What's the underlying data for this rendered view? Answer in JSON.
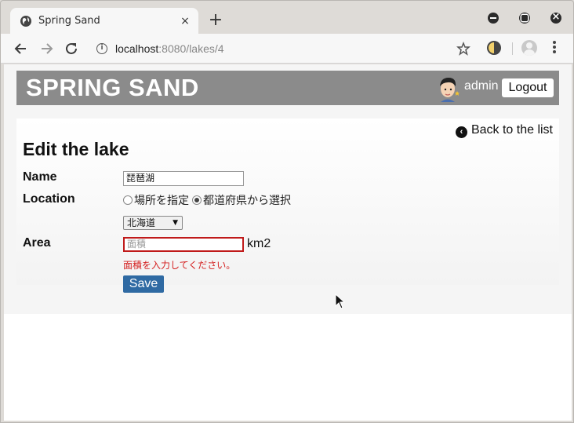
{
  "browser": {
    "tab_title": "Spring Sand",
    "tab_close": "×",
    "new_tab": "+",
    "url_host": "localhost",
    "url_rest": ":8080/lakes/4",
    "icons": {
      "favicon": "globe-icon",
      "back": "back-arrow-icon",
      "forward": "forward-arrow-icon",
      "reload": "reload-icon",
      "info": "info-icon",
      "bookmark": "star-icon",
      "extension": "extension-icon",
      "profile": "profile-icon",
      "menu": "kebab-menu-icon"
    }
  },
  "header": {
    "brand": "SPRING SAND",
    "username": "admin",
    "logout_label": "Logout"
  },
  "form": {
    "back_link": "Back to the list",
    "title": "Edit the lake",
    "name_label": "Name",
    "name_value": "琵琶湖",
    "location_label": "Location",
    "radio_specify": "場所を指定",
    "radio_prefecture": "都道府県から選択",
    "selected_location_mode": "prefecture",
    "prefecture_value": "北海道",
    "area_label": "Area",
    "area_placeholder": "面積",
    "area_value": "",
    "area_unit": "km2",
    "area_error": "面積を入力してください。",
    "save_label": "Save"
  },
  "colors": {
    "header_bg": "#8b8b8b",
    "save_bg": "#2f6aa3",
    "error": "#d42020"
  }
}
